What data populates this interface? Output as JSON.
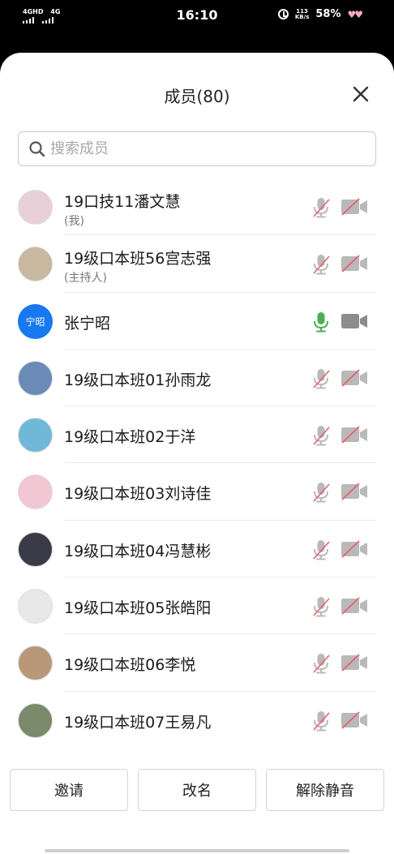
{
  "status_bar": {
    "net1": "4GHD",
    "net2": "4G",
    "time": "16:10",
    "speed_value": "113",
    "speed_unit": "KB/s",
    "battery": "58%"
  },
  "header": {
    "title": "成员(80)"
  },
  "search": {
    "placeholder": "搜索成员"
  },
  "members": [
    {
      "name": "19口技11潘文慧",
      "sub": "(我)",
      "mic": "muted",
      "camera": "off",
      "avatar_color": "#e8d0d8"
    },
    {
      "name": "19级口本班56宫志强",
      "sub": "(主持人)",
      "mic": "muted",
      "camera": "off",
      "avatar_color": "#c8b8a0"
    },
    {
      "name": "张宁昭",
      "sub": "",
      "mic": "on",
      "camera": "on",
      "avatar_text": "宁昭",
      "avatar_color": "#1778ef"
    },
    {
      "name": "19级口本班01孙雨龙",
      "sub": "",
      "mic": "muted",
      "camera": "off",
      "avatar_color": "#6a8ab8"
    },
    {
      "name": "19级口本班02于洋",
      "sub": "",
      "mic": "muted",
      "camera": "off",
      "avatar_color": "#6fb8d8"
    },
    {
      "name": "19级口本班03刘诗佳",
      "sub": "",
      "mic": "muted",
      "camera": "off",
      "avatar_color": "#f3c6d4"
    },
    {
      "name": "19级口本班04冯慧彬",
      "sub": "",
      "mic": "muted",
      "camera": "off",
      "avatar_color": "#3a3a48"
    },
    {
      "name": "19级口本班05张皓阳",
      "sub": "",
      "mic": "muted",
      "camera": "off",
      "avatar_color": "#e8e8e8"
    },
    {
      "name": "19级口本班06李悦",
      "sub": "",
      "mic": "muted",
      "camera": "off",
      "avatar_color": "#b89878"
    },
    {
      "name": "19级口本班07王易凡",
      "sub": "",
      "mic": "muted",
      "camera": "off",
      "avatar_color": "#7a8a6a"
    }
  ],
  "actions": {
    "invite": "邀请",
    "rename": "改名",
    "unmute": "解除静音"
  },
  "colors": {
    "muted_icon": "#b9b9b9",
    "muted_slash": "#e8606a",
    "active_mic": "#4caf50",
    "active_cam": "#8c8c8c"
  }
}
